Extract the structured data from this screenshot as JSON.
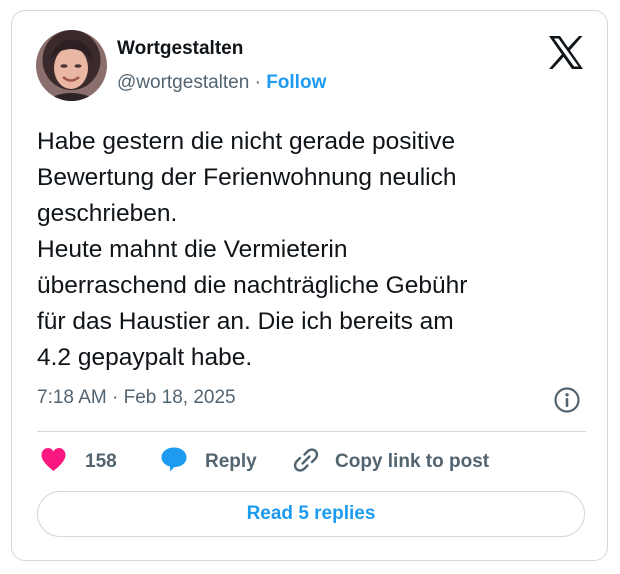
{
  "author": {
    "name": "Wortgestalten",
    "handle": "@wortgestalten",
    "separator": " · ",
    "follow_label": "Follow"
  },
  "icons": {
    "brand": "x-logo-icon",
    "info": "info-icon",
    "like": "heart-icon",
    "reply": "speech-bubble-icon",
    "copy": "link-icon"
  },
  "tweet": {
    "lines": [
      "Habe gestern die nicht gerade positive",
      "Bewertung der Ferienwohnung neulich",
      "geschrieben.",
      "Heute mahnt die Vermieterin",
      "überraschend die nachträgliche Gebühr",
      "für das Haustier an. Die ich bereits am",
      "4.2 gepaypalt habe."
    ]
  },
  "meta": {
    "time": "7:18 AM",
    "separator": " · ",
    "date": "Feb 18, 2025"
  },
  "actions": {
    "like_count": "158",
    "reply_label": "Reply",
    "copy_label": "Copy link to post"
  },
  "read_replies_label": "Read 5 replies",
  "colors": {
    "accent": "#1d9bf0",
    "like": "#f91880",
    "text": "#0f1419",
    "secondary": "#536471",
    "border": "#cfd9de"
  }
}
